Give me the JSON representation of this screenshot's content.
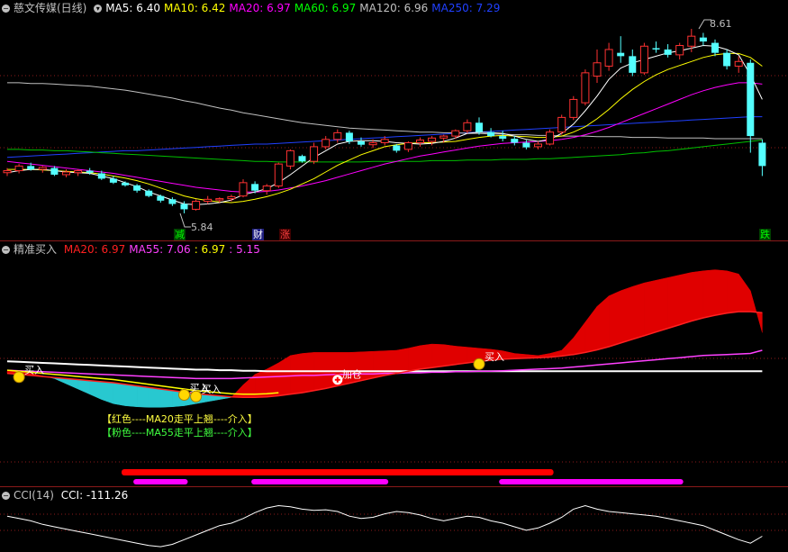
{
  "price_header": {
    "title": "慈文传媒(日线)",
    "ma": [
      {
        "label": "MA5: ",
        "value": "6.40",
        "color": "#ffffff"
      },
      {
        "label": "MA10: ",
        "value": "6.42",
        "color": "#ffff00"
      },
      {
        "label": "MA20: ",
        "value": "6.97",
        "color": "#ff00ff"
      },
      {
        "label": "MA60: ",
        "value": "6.97",
        "color": "#00ff00"
      },
      {
        "label": "MA120: ",
        "value": "6.96",
        "color": "#c0c0c0"
      },
      {
        "label": "MA250: ",
        "value": "7.29",
        "color": "#2040ff"
      }
    ]
  },
  "price_annotations": {
    "high": "8.61",
    "low": "5.84"
  },
  "badges": [
    {
      "text": "减",
      "color": "#00ff00",
      "bg": "#004000"
    },
    {
      "text": "财",
      "color": "#ffffff",
      "bg": "#202080"
    },
    {
      "text": "涨",
      "color": "#ff4040",
      "bg": "#400000"
    },
    {
      "text": "跌",
      "color": "#00ff00",
      "bg": "#004000"
    }
  ],
  "indicator_header": {
    "title": "精准买入",
    "parts": [
      {
        "text": "MA20: 6.97",
        "color": "#ff2020"
      },
      {
        "text": "MA55: 7.06",
        "color": "#ff40ff"
      },
      {
        "text": ": 6.97",
        "color": "#ffff00"
      },
      {
        "text": ": 5.15",
        "color": "#ff40ff"
      }
    ]
  },
  "signals": {
    "buy": "买入",
    "add": "加仓"
  },
  "legend_notes": [
    {
      "text": "【红色----MA20走平上翘----介入】",
      "color": "#ffff40"
    },
    {
      "text": "【粉色----MA55走平上翘----介入】",
      "color": "#40ff40"
    }
  ],
  "cci_header": {
    "title": "CCI(14)",
    "value_label": "CCI: -111.26"
  },
  "colors": {
    "up": "#ff3232",
    "down": "#54ffff",
    "ma5": "#ffffff",
    "ma10": "#ffff00",
    "ma20": "#ff00ff",
    "ma60": "#00c000",
    "ma120": "#c0c0c0",
    "ma250": "#2040ff",
    "grid": "#8b1a1a"
  },
  "candles": [
    [
      6.45,
      6.52,
      6.4,
      6.48
    ],
    [
      6.48,
      6.58,
      6.44,
      6.55
    ],
    [
      6.55,
      6.6,
      6.48,
      6.5
    ],
    [
      6.5,
      6.55,
      6.45,
      6.53
    ],
    [
      6.52,
      6.55,
      6.4,
      6.42
    ],
    [
      6.42,
      6.5,
      6.38,
      6.46
    ],
    [
      6.45,
      6.5,
      6.4,
      6.48
    ],
    [
      6.48,
      6.52,
      6.42,
      6.45
    ],
    [
      6.44,
      6.48,
      6.34,
      6.36
    ],
    [
      6.36,
      6.4,
      6.28,
      6.3
    ],
    [
      6.3,
      6.32,
      6.24,
      6.26
    ],
    [
      6.26,
      6.28,
      6.15,
      6.18
    ],
    [
      6.18,
      6.2,
      6.08,
      6.1
    ],
    [
      6.1,
      6.12,
      6.0,
      6.03
    ],
    [
      6.05,
      6.08,
      5.95,
      5.98
    ],
    [
      5.98,
      6.02,
      5.84,
      5.9
    ],
    [
      5.9,
      6.05,
      5.88,
      6.02
    ],
    [
      6.02,
      6.1,
      5.98,
      6.05
    ],
    [
      6.04,
      6.08,
      6.0,
      6.06
    ],
    [
      6.06,
      6.12,
      6.02,
      6.09
    ],
    [
      6.1,
      6.35,
      6.08,
      6.3
    ],
    [
      6.28,
      6.32,
      6.14,
      6.18
    ],
    [
      6.18,
      6.28,
      6.12,
      6.25
    ],
    [
      6.25,
      6.6,
      6.22,
      6.58
    ],
    [
      6.55,
      6.8,
      6.5,
      6.78
    ],
    [
      6.7,
      6.72,
      6.6,
      6.62
    ],
    [
      6.62,
      6.9,
      6.58,
      6.84
    ],
    [
      6.84,
      7.0,
      6.8,
      6.95
    ],
    [
      6.95,
      7.1,
      6.9,
      7.05
    ],
    [
      7.05,
      7.08,
      6.88,
      6.92
    ],
    [
      6.92,
      6.98,
      6.84,
      6.87
    ],
    [
      6.87,
      6.95,
      6.82,
      6.9
    ],
    [
      6.9,
      7.0,
      6.86,
      6.95
    ],
    [
      6.86,
      6.88,
      6.75,
      6.78
    ],
    [
      6.8,
      6.92,
      6.76,
      6.9
    ],
    [
      6.9,
      6.98,
      6.84,
      6.94
    ],
    [
      6.92,
      7.0,
      6.86,
      6.97
    ],
    [
      6.97,
      7.02,
      6.9,
      7.0
    ],
    [
      7.0,
      7.1,
      6.96,
      7.08
    ],
    [
      7.08,
      7.25,
      7.04,
      7.2
    ],
    [
      7.2,
      7.28,
      7.02,
      7.06
    ],
    [
      7.06,
      7.12,
      6.98,
      7.0
    ],
    [
      7.0,
      7.08,
      6.92,
      6.96
    ],
    [
      6.96,
      7.0,
      6.86,
      6.9
    ],
    [
      6.9,
      6.94,
      6.8,
      6.83
    ],
    [
      6.84,
      6.92,
      6.8,
      6.88
    ],
    [
      6.88,
      7.1,
      6.86,
      7.06
    ],
    [
      7.06,
      7.32,
      7.02,
      7.28
    ],
    [
      7.28,
      7.6,
      7.24,
      7.55
    ],
    [
      7.5,
      8.0,
      7.46,
      7.95
    ],
    [
      7.9,
      8.3,
      7.8,
      8.1
    ],
    [
      8.05,
      8.4,
      7.98,
      8.3
    ],
    [
      8.25,
      8.5,
      8.1,
      8.2
    ],
    [
      8.2,
      8.3,
      7.9,
      7.95
    ],
    [
      7.95,
      8.4,
      7.92,
      8.35
    ],
    [
      8.32,
      8.42,
      8.25,
      8.3
    ],
    [
      8.3,
      8.38,
      8.18,
      8.22
    ],
    [
      8.22,
      8.4,
      8.15,
      8.36
    ],
    [
      8.35,
      8.61,
      8.26,
      8.5
    ],
    [
      8.48,
      8.55,
      8.36,
      8.42
    ],
    [
      8.4,
      8.45,
      8.2,
      8.25
    ],
    [
      8.25,
      8.3,
      8.0,
      8.05
    ],
    [
      8.05,
      8.2,
      7.95,
      8.12
    ],
    [
      8.1,
      8.15,
      6.75,
      7.0
    ],
    [
      6.9,
      6.95,
      6.4,
      6.55
    ]
  ],
  "ma_series": {
    "ma5": [
      6.45,
      6.48,
      6.5,
      6.5,
      6.48,
      6.46,
      6.45,
      6.44,
      6.4,
      6.36,
      6.3,
      6.24,
      6.16,
      6.1,
      6.04,
      5.98,
      5.97,
      5.98,
      6.0,
      6.04,
      6.12,
      6.16,
      6.21,
      6.3,
      6.42,
      6.55,
      6.68,
      6.78,
      6.88,
      6.92,
      6.93,
      6.93,
      6.92,
      6.9,
      6.89,
      6.88,
      6.89,
      6.92,
      6.97,
      7.04,
      7.06,
      7.05,
      7.04,
      7.0,
      6.95,
      6.92,
      6.95,
      7.04,
      7.18,
      7.38,
      7.6,
      7.85,
      8.02,
      8.1,
      8.15,
      8.2,
      8.25,
      8.28,
      8.32,
      8.36,
      8.35,
      8.3,
      8.22,
      7.92,
      7.55
    ],
    "ma10": [
      6.5,
      6.5,
      6.5,
      6.49,
      6.48,
      6.47,
      6.46,
      6.45,
      6.43,
      6.4,
      6.37,
      6.33,
      6.28,
      6.22,
      6.16,
      6.1,
      6.06,
      6.03,
      6.01,
      6.0,
      6.02,
      6.05,
      6.09,
      6.14,
      6.2,
      6.28,
      6.36,
      6.46,
      6.56,
      6.64,
      6.72,
      6.78,
      6.84,
      6.87,
      6.89,
      6.9,
      6.9,
      6.91,
      6.92,
      6.95,
      6.98,
      7.0,
      7.01,
      7.0,
      6.99,
      6.98,
      6.98,
      7.0,
      7.06,
      7.14,
      7.26,
      7.4,
      7.56,
      7.7,
      7.82,
      7.92,
      8.0,
      8.06,
      8.12,
      8.18,
      8.22,
      8.24,
      8.24,
      8.18,
      8.05
    ],
    "ma20": [
      6.62,
      6.6,
      6.58,
      6.56,
      6.54,
      6.52,
      6.5,
      6.48,
      6.46,
      6.44,
      6.41,
      6.38,
      6.35,
      6.32,
      6.29,
      6.26,
      6.23,
      6.21,
      6.19,
      6.17,
      6.16,
      6.16,
      6.17,
      6.19,
      6.22,
      6.25,
      6.29,
      6.33,
      6.38,
      6.43,
      6.48,
      6.53,
      6.58,
      6.62,
      6.66,
      6.7,
      6.73,
      6.76,
      6.79,
      6.82,
      6.85,
      6.87,
      6.89,
      6.9,
      6.91,
      6.92,
      6.93,
      6.95,
      6.98,
      7.02,
      7.07,
      7.13,
      7.2,
      7.27,
      7.34,
      7.41,
      7.48,
      7.55,
      7.62,
      7.68,
      7.73,
      7.77,
      7.8,
      7.8,
      7.78
    ],
    "ma60": [
      6.8,
      6.8,
      6.79,
      6.79,
      6.78,
      6.78,
      6.77,
      6.76,
      6.75,
      6.74,
      6.73,
      6.72,
      6.71,
      6.7,
      6.69,
      6.68,
      6.67,
      6.66,
      6.65,
      6.64,
      6.63,
      6.62,
      6.62,
      6.61,
      6.61,
      6.61,
      6.61,
      6.61,
      6.61,
      6.61,
      6.61,
      6.62,
      6.62,
      6.62,
      6.62,
      6.62,
      6.63,
      6.63,
      6.63,
      6.64,
      6.64,
      6.64,
      6.65,
      6.65,
      6.65,
      6.66,
      6.66,
      6.67,
      6.68,
      6.69,
      6.7,
      6.71,
      6.72,
      6.74,
      6.75,
      6.77,
      6.78,
      6.8,
      6.82,
      6.84,
      6.86,
      6.88,
      6.9,
      6.92,
      6.94
    ],
    "ma120": [
      7.8,
      7.8,
      7.79,
      7.79,
      7.78,
      7.77,
      7.76,
      7.75,
      7.73,
      7.71,
      7.69,
      7.66,
      7.63,
      7.6,
      7.57,
      7.53,
      7.5,
      7.46,
      7.42,
      7.39,
      7.35,
      7.32,
      7.29,
      7.26,
      7.23,
      7.2,
      7.18,
      7.16,
      7.14,
      7.12,
      7.11,
      7.1,
      7.09,
      7.08,
      7.07,
      7.06,
      7.06,
      7.05,
      7.05,
      7.04,
      7.04,
      7.03,
      7.03,
      7.02,
      7.02,
      7.01,
      7.01,
      7.0,
      7.0,
      7.0,
      6.99,
      6.99,
      6.99,
      6.98,
      6.98,
      6.98,
      6.97,
      6.97,
      6.97,
      6.97,
      6.96,
      6.96,
      6.96,
      6.96,
      6.96
    ],
    "ma250": [
      6.68,
      6.69,
      6.7,
      6.71,
      6.72,
      6.73,
      6.74,
      6.75,
      6.76,
      6.77,
      6.78,
      6.78,
      6.79,
      6.8,
      6.81,
      6.82,
      6.83,
      6.84,
      6.85,
      6.86,
      6.87,
      6.88,
      6.88,
      6.89,
      6.9,
      6.91,
      6.92,
      6.93,
      6.94,
      6.95,
      6.96,
      6.97,
      6.98,
      6.99,
      7.0,
      7.01,
      7.02,
      7.03,
      7.04,
      7.05,
      7.06,
      7.07,
      7.08,
      7.09,
      7.1,
      7.11,
      7.12,
      7.13,
      7.14,
      7.15,
      7.16,
      7.17,
      7.18,
      7.19,
      7.2,
      7.21,
      7.22,
      7.23,
      7.24,
      7.25,
      7.26,
      7.27,
      7.28,
      7.29,
      7.29
    ]
  },
  "indicator_series": {
    "white": [
      6.85,
      6.84,
      6.83,
      6.82,
      6.81,
      6.8,
      6.79,
      6.78,
      6.77,
      6.76,
      6.75,
      6.74,
      6.73,
      6.72,
      6.71,
      6.7,
      6.69,
      6.69,
      6.68,
      6.68,
      6.67,
      6.67,
      6.66,
      6.66,
      6.66,
      6.66,
      6.66,
      6.66,
      6.66,
      6.66,
      6.66,
      6.66,
      6.66,
      6.66,
      6.66,
      6.66,
      6.66,
      6.66,
      6.66,
      6.66,
      6.66,
      6.66,
      6.66,
      6.66,
      6.66,
      6.66,
      6.66,
      6.66,
      6.66,
      6.66,
      6.66,
      6.66,
      6.66,
      6.66,
      6.66,
      6.66,
      6.66,
      6.66,
      6.66,
      6.66,
      6.66,
      6.66,
      6.66,
      6.66,
      6.66
    ],
    "ma55": [
      6.68,
      6.67,
      6.66,
      6.65,
      6.64,
      6.63,
      6.62,
      6.61,
      6.6,
      6.59,
      6.58,
      6.57,
      6.56,
      6.55,
      6.54,
      6.53,
      6.52,
      6.52,
      6.52,
      6.52,
      6.53,
      6.54,
      6.55,
      6.56,
      6.57,
      6.58,
      6.58,
      6.59,
      6.6,
      6.6,
      6.61,
      6.61,
      6.62,
      6.62,
      6.63,
      6.63,
      6.64,
      6.64,
      6.65,
      6.65,
      6.66,
      6.66,
      6.67,
      6.68,
      6.69,
      6.7,
      6.71,
      6.72,
      6.74,
      6.76,
      6.78,
      6.8,
      6.82,
      6.84,
      6.86,
      6.88,
      6.9,
      6.92,
      6.94,
      6.96,
      6.97,
      6.98,
      6.99,
      7.0,
      7.06
    ],
    "ma20": [
      6.62,
      6.6,
      6.58,
      6.56,
      6.54,
      6.52,
      6.5,
      6.48,
      6.46,
      6.44,
      6.41,
      6.38,
      6.35,
      6.32,
      6.29,
      6.26,
      6.23,
      6.21,
      6.19,
      6.17,
      6.16,
      6.16,
      6.17,
      6.19,
      6.22,
      6.25,
      6.29,
      6.33,
      6.38,
      6.43,
      6.48,
      6.53,
      6.58,
      6.62,
      6.66,
      6.7,
      6.73,
      6.76,
      6.79,
      6.82,
      6.85,
      6.87,
      6.89,
      6.9,
      6.91,
      6.92,
      6.93,
      6.95,
      6.98,
      7.02,
      7.07,
      7.13,
      7.2,
      7.27,
      7.34,
      7.41,
      7.48,
      7.55,
      7.62,
      7.68,
      7.73,
      7.77,
      7.8,
      7.8,
      7.78
    ],
    "fast": [
      6.66,
      6.67,
      6.62,
      6.57,
      6.52,
      6.42,
      6.32,
      6.22,
      6.12,
      6.04,
      6.0,
      5.98,
      5.97,
      5.97,
      5.98,
      6.0,
      6.04,
      6.08,
      6.12,
      6.16,
      6.4,
      6.6,
      6.7,
      6.82,
      6.96,
      7.0,
      7.02,
      7.02,
      7.02,
      7.02,
      7.03,
      7.04,
      7.05,
      7.06,
      7.1,
      7.15,
      7.18,
      7.17,
      7.14,
      7.12,
      7.1,
      7.08,
      7.05,
      7.0,
      6.98,
      6.96,
      7.0,
      7.06,
      7.3,
      7.6,
      7.9,
      8.1,
      8.2,
      8.28,
      8.35,
      8.4,
      8.45,
      8.5,
      8.55,
      8.58,
      8.6,
      8.58,
      8.52,
      8.2,
      7.4
    ]
  },
  "buy_marks": [
    1,
    15,
    16,
    40
  ],
  "add_mark": [
    28
  ],
  "bars": {
    "red": [
      [
        10,
        20
      ],
      [
        20,
        38
      ],
      [
        38,
        46
      ]
    ],
    "magenta": [
      [
        11,
        15
      ],
      [
        21,
        32
      ],
      [
        42,
        57
      ]
    ]
  },
  "cci": [
    60,
    40,
    20,
    -10,
    -30,
    -50,
    -70,
    -90,
    -110,
    -130,
    -150,
    -170,
    -190,
    -200,
    -180,
    -140,
    -100,
    -60,
    -20,
    0,
    40,
    90,
    130,
    150,
    140,
    120,
    110,
    115,
    100,
    60,
    40,
    50,
    80,
    100,
    90,
    70,
    40,
    20,
    40,
    60,
    50,
    20,
    0,
    -30,
    -60,
    -40,
    0,
    50,
    120,
    150,
    120,
    100,
    90,
    80,
    70,
    60,
    40,
    20,
    0,
    -20,
    -60,
    -100,
    -140,
    -170,
    -111
  ]
}
